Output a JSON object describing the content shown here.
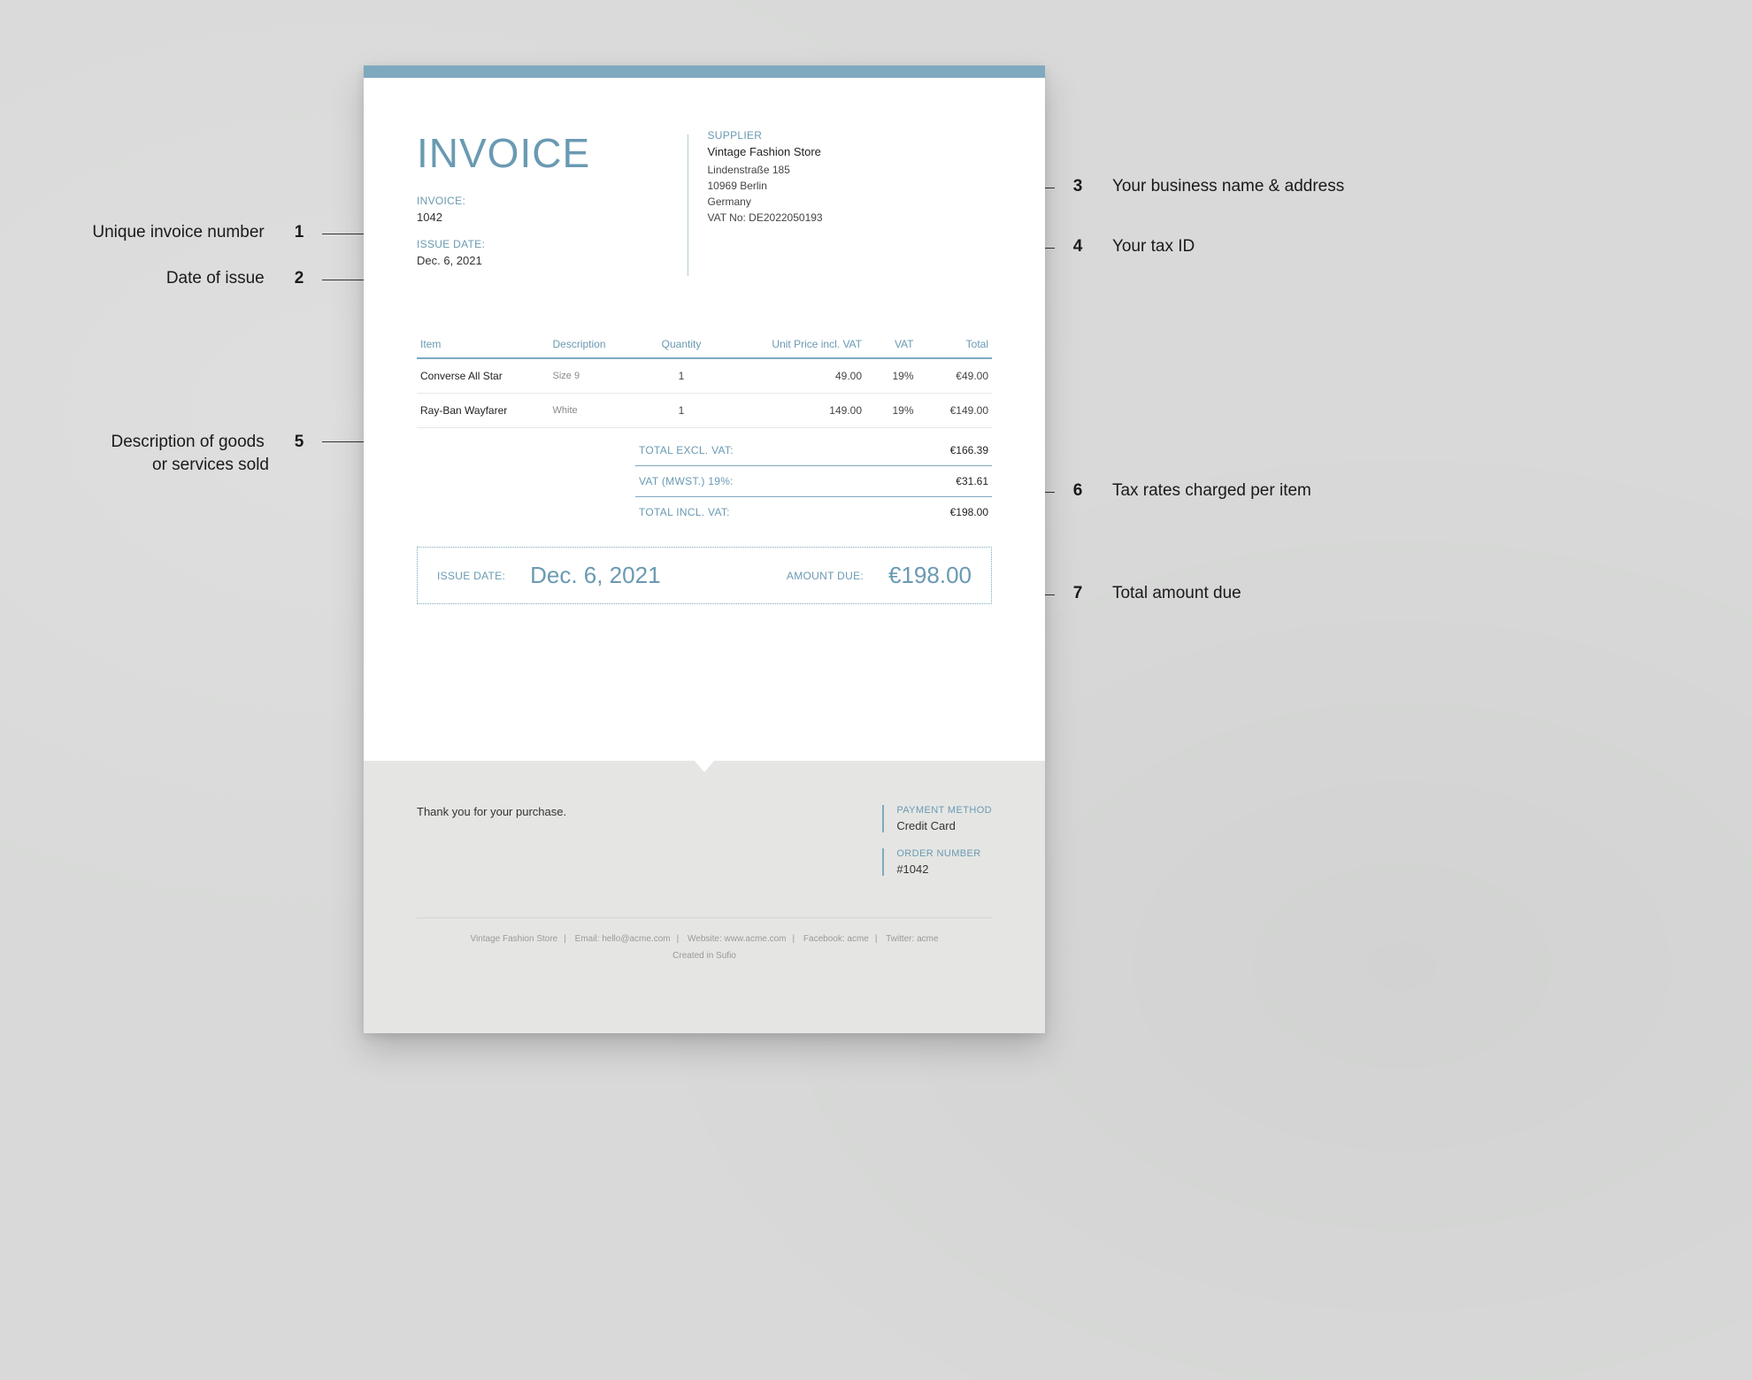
{
  "annotations": {
    "a1": {
      "num": "1",
      "text": "Unique invoice number"
    },
    "a2": {
      "num": "2",
      "text": "Date of issue"
    },
    "a3": {
      "num": "3",
      "text": "Your business name & address"
    },
    "a4": {
      "num": "4",
      "text": "Your tax ID"
    },
    "a5": {
      "num": "5",
      "text": "Description of goods",
      "text2": "or services sold"
    },
    "a6": {
      "num": "6",
      "text": "Tax rates charged per item"
    },
    "a7": {
      "num": "7",
      "text": "Total amount due"
    }
  },
  "invoice": {
    "title": "INVOICE",
    "number_label": "INVOICE:",
    "number": "1042",
    "issue_label": "ISSUE DATE:",
    "issue_date": "Dec. 6, 2021",
    "supplier_label": "SUPPLIER",
    "supplier": {
      "name": "Vintage Fashion Store",
      "street": "Lindenstraße 185",
      "city": "10969 Berlin",
      "country": "Germany",
      "vat_no": "VAT No: DE2022050193"
    }
  },
  "table": {
    "headers": {
      "item": "Item",
      "desc": "Description",
      "qty": "Quantity",
      "unit": "Unit Price incl. VAT",
      "vat": "VAT",
      "total": "Total"
    },
    "rows": [
      {
        "item": "Converse All Star",
        "desc": "Size 9",
        "qty": "1",
        "unit": "49.00",
        "vat": "19%",
        "total": "€49.00"
      },
      {
        "item": "Ray-Ban Wayfarer",
        "desc": "White",
        "qty": "1",
        "unit": "149.00",
        "vat": "19%",
        "total": "€149.00"
      }
    ]
  },
  "totals": {
    "excl_label": "TOTAL EXCL. VAT:",
    "excl": "€166.39",
    "vat_label": "VAT (MWST.) 19%:",
    "vat": "€31.61",
    "incl_label": "TOTAL INCL. VAT:",
    "incl": "€198.00"
  },
  "due": {
    "issue_label": "ISSUE DATE:",
    "issue": "Dec. 6, 2021",
    "amount_label": "AMOUNT DUE:",
    "amount": "€198.00"
  },
  "footer": {
    "thanks": "Thank you for your purchase.",
    "payment_label": "PAYMENT METHOD",
    "payment": "Credit Card",
    "order_label": "ORDER NUMBER",
    "order": "#1042",
    "line": {
      "store": "Vintage Fashion Store",
      "email": "Email: hello@acme.com",
      "web": "Website: www.acme.com",
      "fb": "Facebook: acme",
      "tw": "Twitter: acme"
    },
    "credit": "Created in Sufio"
  }
}
